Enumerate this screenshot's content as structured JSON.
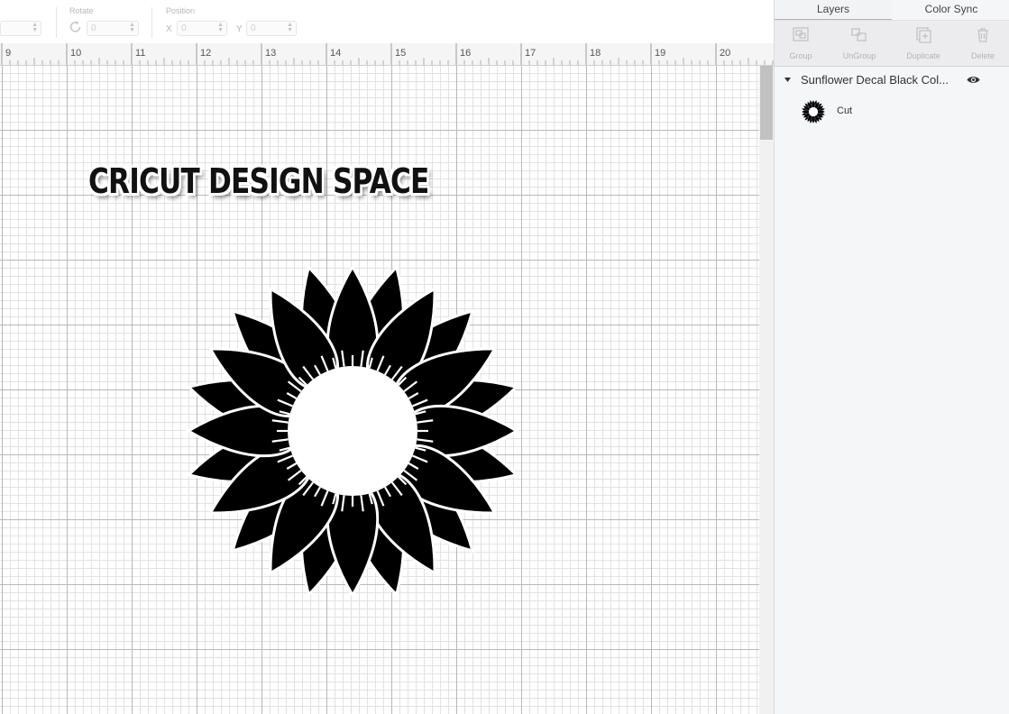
{
  "toolbar": {
    "rotate_label": "Rotate",
    "rotate_value": "0",
    "position_label": "Position",
    "x_label": "X",
    "x_value": "0",
    "y_label": "Y",
    "y_value": "0",
    "partial_value": "0"
  },
  "ruler": {
    "labels": [
      "9",
      "10",
      "11",
      "12",
      "13",
      "14",
      "15",
      "16",
      "17",
      "18",
      "19",
      "20"
    ]
  },
  "canvas": {
    "watermark": "CRICUT DESIGN SPACE",
    "design_name": "sunflower-decal"
  },
  "panel": {
    "tabs": [
      {
        "label": "Layers",
        "active": true
      },
      {
        "label": "Color Sync",
        "active": false
      }
    ],
    "tools": [
      {
        "label": "Group",
        "icon": "group-icon"
      },
      {
        "label": "UnGroup",
        "icon": "ungroup-icon"
      },
      {
        "label": "Duplicate",
        "icon": "duplicate-icon"
      },
      {
        "label": "Delete",
        "icon": "trash-icon"
      }
    ],
    "layer_group": {
      "name": "Sunflower Decal Black Col...",
      "visibility_icon": "eye-icon"
    },
    "layers": [
      {
        "name": "Cut",
        "thumb_icon": "sunflower-thumbnail-icon"
      }
    ]
  },
  "colors": {
    "design_fill": "#000000",
    "grid_major": "#b8b8b8",
    "grid_minor": "#e2e2e2",
    "panel_bg": "#f5f6f8"
  }
}
